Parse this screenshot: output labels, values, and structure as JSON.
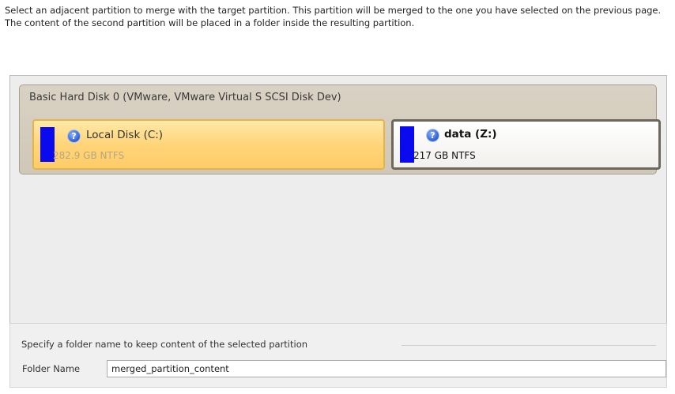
{
  "instruction": "Select an adjacent partition to merge with the target partition. This partition will be merged to the one you have selected on the previous page. The content of the second partition will be placed in a folder inside the resulting partition.",
  "disk": {
    "title": "Basic Hard Disk 0 (VMware, VMware Virtual S SCSI Disk Dev)",
    "partitions": [
      {
        "name": "Local Disk (C:)",
        "size": "282.9 GB NTFS",
        "selected": true,
        "icon": "help-icon"
      },
      {
        "name": "data (Z:)",
        "size": "217 GB NTFS",
        "selected": false,
        "icon": "help-icon"
      }
    ]
  },
  "folder": {
    "legend": "Specify a folder name to keep content of the selected partition",
    "label": "Folder Name",
    "value": "merged_partition_content"
  },
  "colors": {
    "partition_bar": "#0a0aee",
    "selected_fill": "#ffd57a",
    "disk_group": "#d9d2c4"
  }
}
